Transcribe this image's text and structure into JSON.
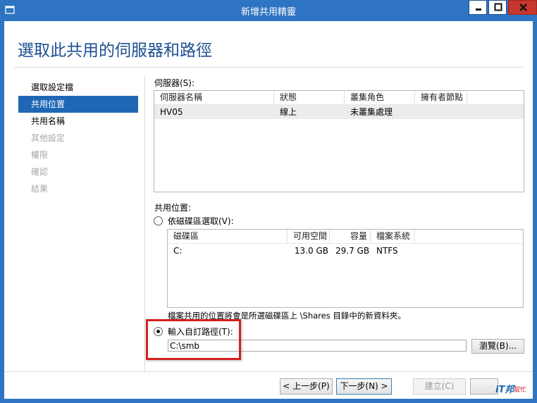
{
  "window": {
    "title": "新增共用精靈"
  },
  "page_title": "選取此共用的伺服器和路徑",
  "nav": {
    "items": [
      {
        "label": "選取設定檔",
        "state": "normal"
      },
      {
        "label": "共用位置",
        "state": "active"
      },
      {
        "label": "共用名稱",
        "state": "normal"
      },
      {
        "label": "其他設定",
        "state": "disabled"
      },
      {
        "label": "權限",
        "state": "disabled"
      },
      {
        "label": "確認",
        "state": "disabled"
      },
      {
        "label": "結果",
        "state": "disabled"
      }
    ]
  },
  "server": {
    "label": "伺服器(S):",
    "columns": [
      "伺服器名稱",
      "狀態",
      "叢集角色",
      "擁有者節點"
    ],
    "rows": [
      {
        "name": "HV05",
        "status": "線上",
        "cluster_role": "未叢集處理",
        "owner": ""
      }
    ]
  },
  "share_location": {
    "label": "共用位置:",
    "radio_volume_label": "依磁碟區選取(V):",
    "volume_columns": [
      "磁碟區",
      "可用空間",
      "容量",
      "檔案系統"
    ],
    "volumes": [
      {
        "volume": "C:",
        "free": "13.0 GB",
        "capacity": "29.7 GB",
        "fs": "NTFS"
      }
    ],
    "note": "檔案共用的位置將會是所選磁碟區上 \\Shares 目錄中的新資料夾。",
    "radio_custom_label": "輸入自訂路徑(T):",
    "custom_path_value": "C:\\smb",
    "browse_label": "瀏覽(B)..."
  },
  "footer": {
    "prev_label": "< 上一步(P)",
    "next_label": "下一步(N) >",
    "create_label": "建立(C)"
  },
  "watermark": {
    "line1": "iT邦",
    "line2": "幫忙"
  },
  "colors": {
    "accent": "#1f67b5",
    "title_bar": "#2f74c2",
    "highlight": "#d42020"
  }
}
